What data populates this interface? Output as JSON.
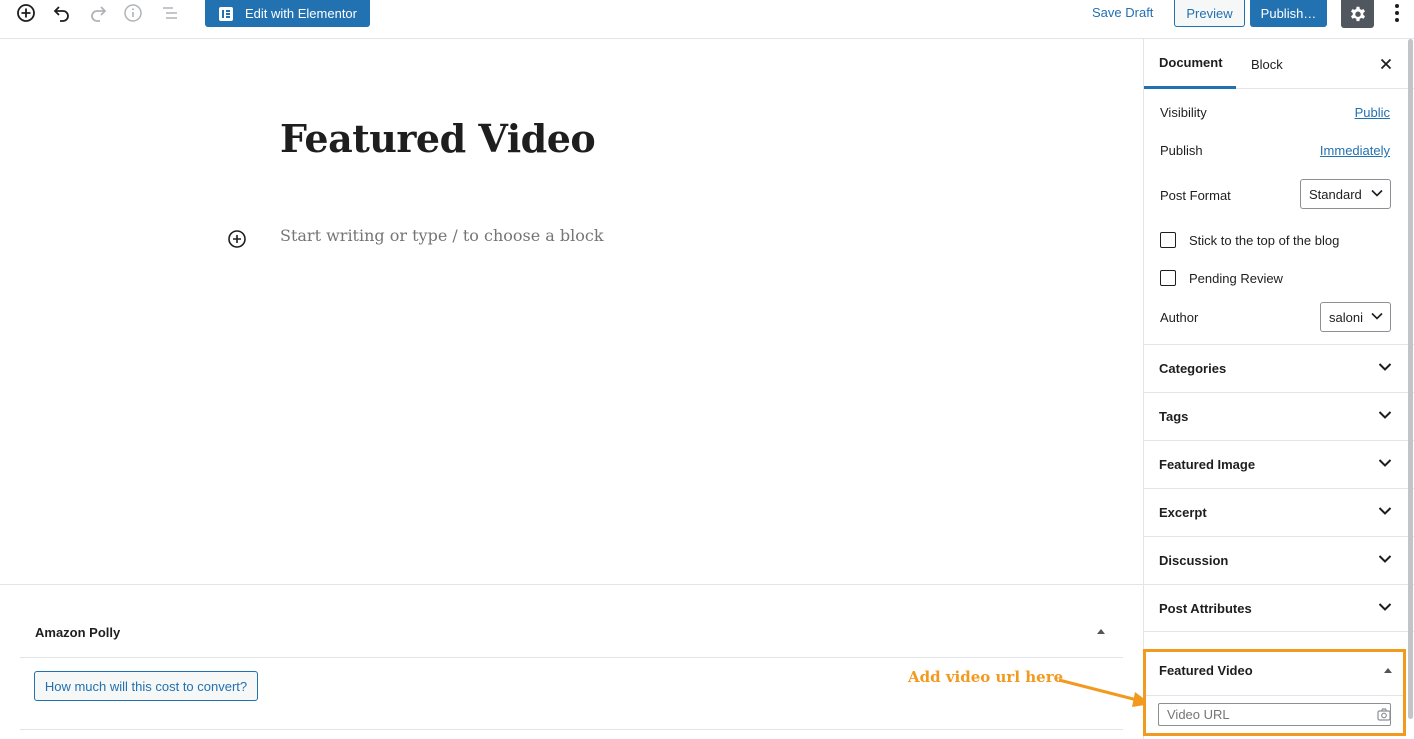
{
  "toolbar": {
    "elementor_label": "Edit with Elementor",
    "save_draft_label": "Save Draft",
    "preview_label": "Preview",
    "publish_label": "Publish…",
    "icons": [
      "add-block-icon",
      "undo-icon",
      "redo-icon",
      "info-icon",
      "outline-icon",
      "gear-icon",
      "more-vertical-icon"
    ],
    "accent_color": "#2271b1"
  },
  "editor": {
    "title": "Featured Video",
    "placeholder": "Start writing or type / to choose a block"
  },
  "metabox": {
    "title": "Amazon Polly",
    "button_label": "How much will this cost to convert?"
  },
  "annotation": {
    "text": "Add video url here",
    "color": "#f29a1f"
  },
  "sidebar": {
    "tabs": [
      {
        "label": "Document",
        "active": true
      },
      {
        "label": "Block",
        "active": false
      }
    ],
    "visibility": {
      "label": "Visibility",
      "value": "Public"
    },
    "publish": {
      "label": "Publish",
      "value": "Immediately"
    },
    "post_format": {
      "label": "Post Format",
      "value": "Standard"
    },
    "stick_top": {
      "label": "Stick to the top of the blog",
      "checked": false
    },
    "pending_review": {
      "label": "Pending Review",
      "checked": false
    },
    "author": {
      "label": "Author",
      "value": "saloni"
    },
    "panels": [
      {
        "title": "Categories"
      },
      {
        "title": "Tags"
      },
      {
        "title": "Featured Image"
      },
      {
        "title": "Excerpt"
      },
      {
        "title": "Discussion"
      },
      {
        "title": "Post Attributes"
      }
    ],
    "featured_video": {
      "title": "Featured Video",
      "input_placeholder": "Video URL"
    }
  }
}
